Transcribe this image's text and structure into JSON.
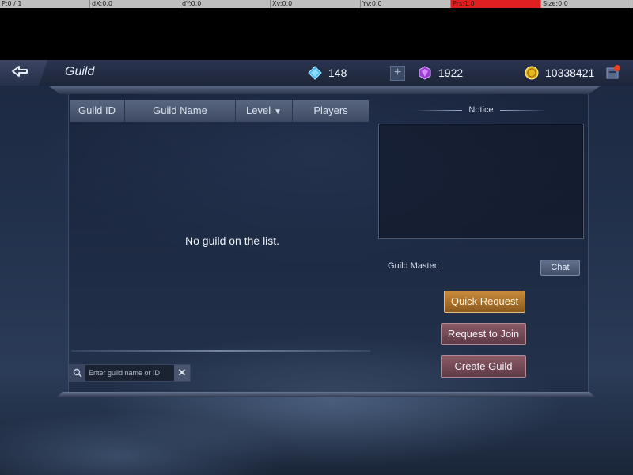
{
  "debug_bar": [
    "P:0 / 1",
    "dX:0.0",
    "dY:0.0",
    "Xv:0.0",
    "Yv:0.0",
    "Prs:1.0",
    "Size:0.0"
  ],
  "header": {
    "title": "Guild",
    "diamonds": "148",
    "crystals": "1922",
    "gold": "10338421"
  },
  "table": {
    "columns": [
      "Guild ID",
      "Guild Name",
      "Level",
      "Players"
    ],
    "empty_message": "No guild on the list."
  },
  "search": {
    "placeholder": "Enter guild name or ID"
  },
  "notice": {
    "title": "Notice"
  },
  "guild_master": {
    "label": "Guild Master:"
  },
  "buttons": {
    "chat": "Chat",
    "quick_request": "Quick Request",
    "request_to_join": "Request to Join",
    "create_guild": "Create Guild"
  },
  "colors": {
    "accent_gold": "#c88a3a",
    "highlight_red": "#e02020"
  }
}
